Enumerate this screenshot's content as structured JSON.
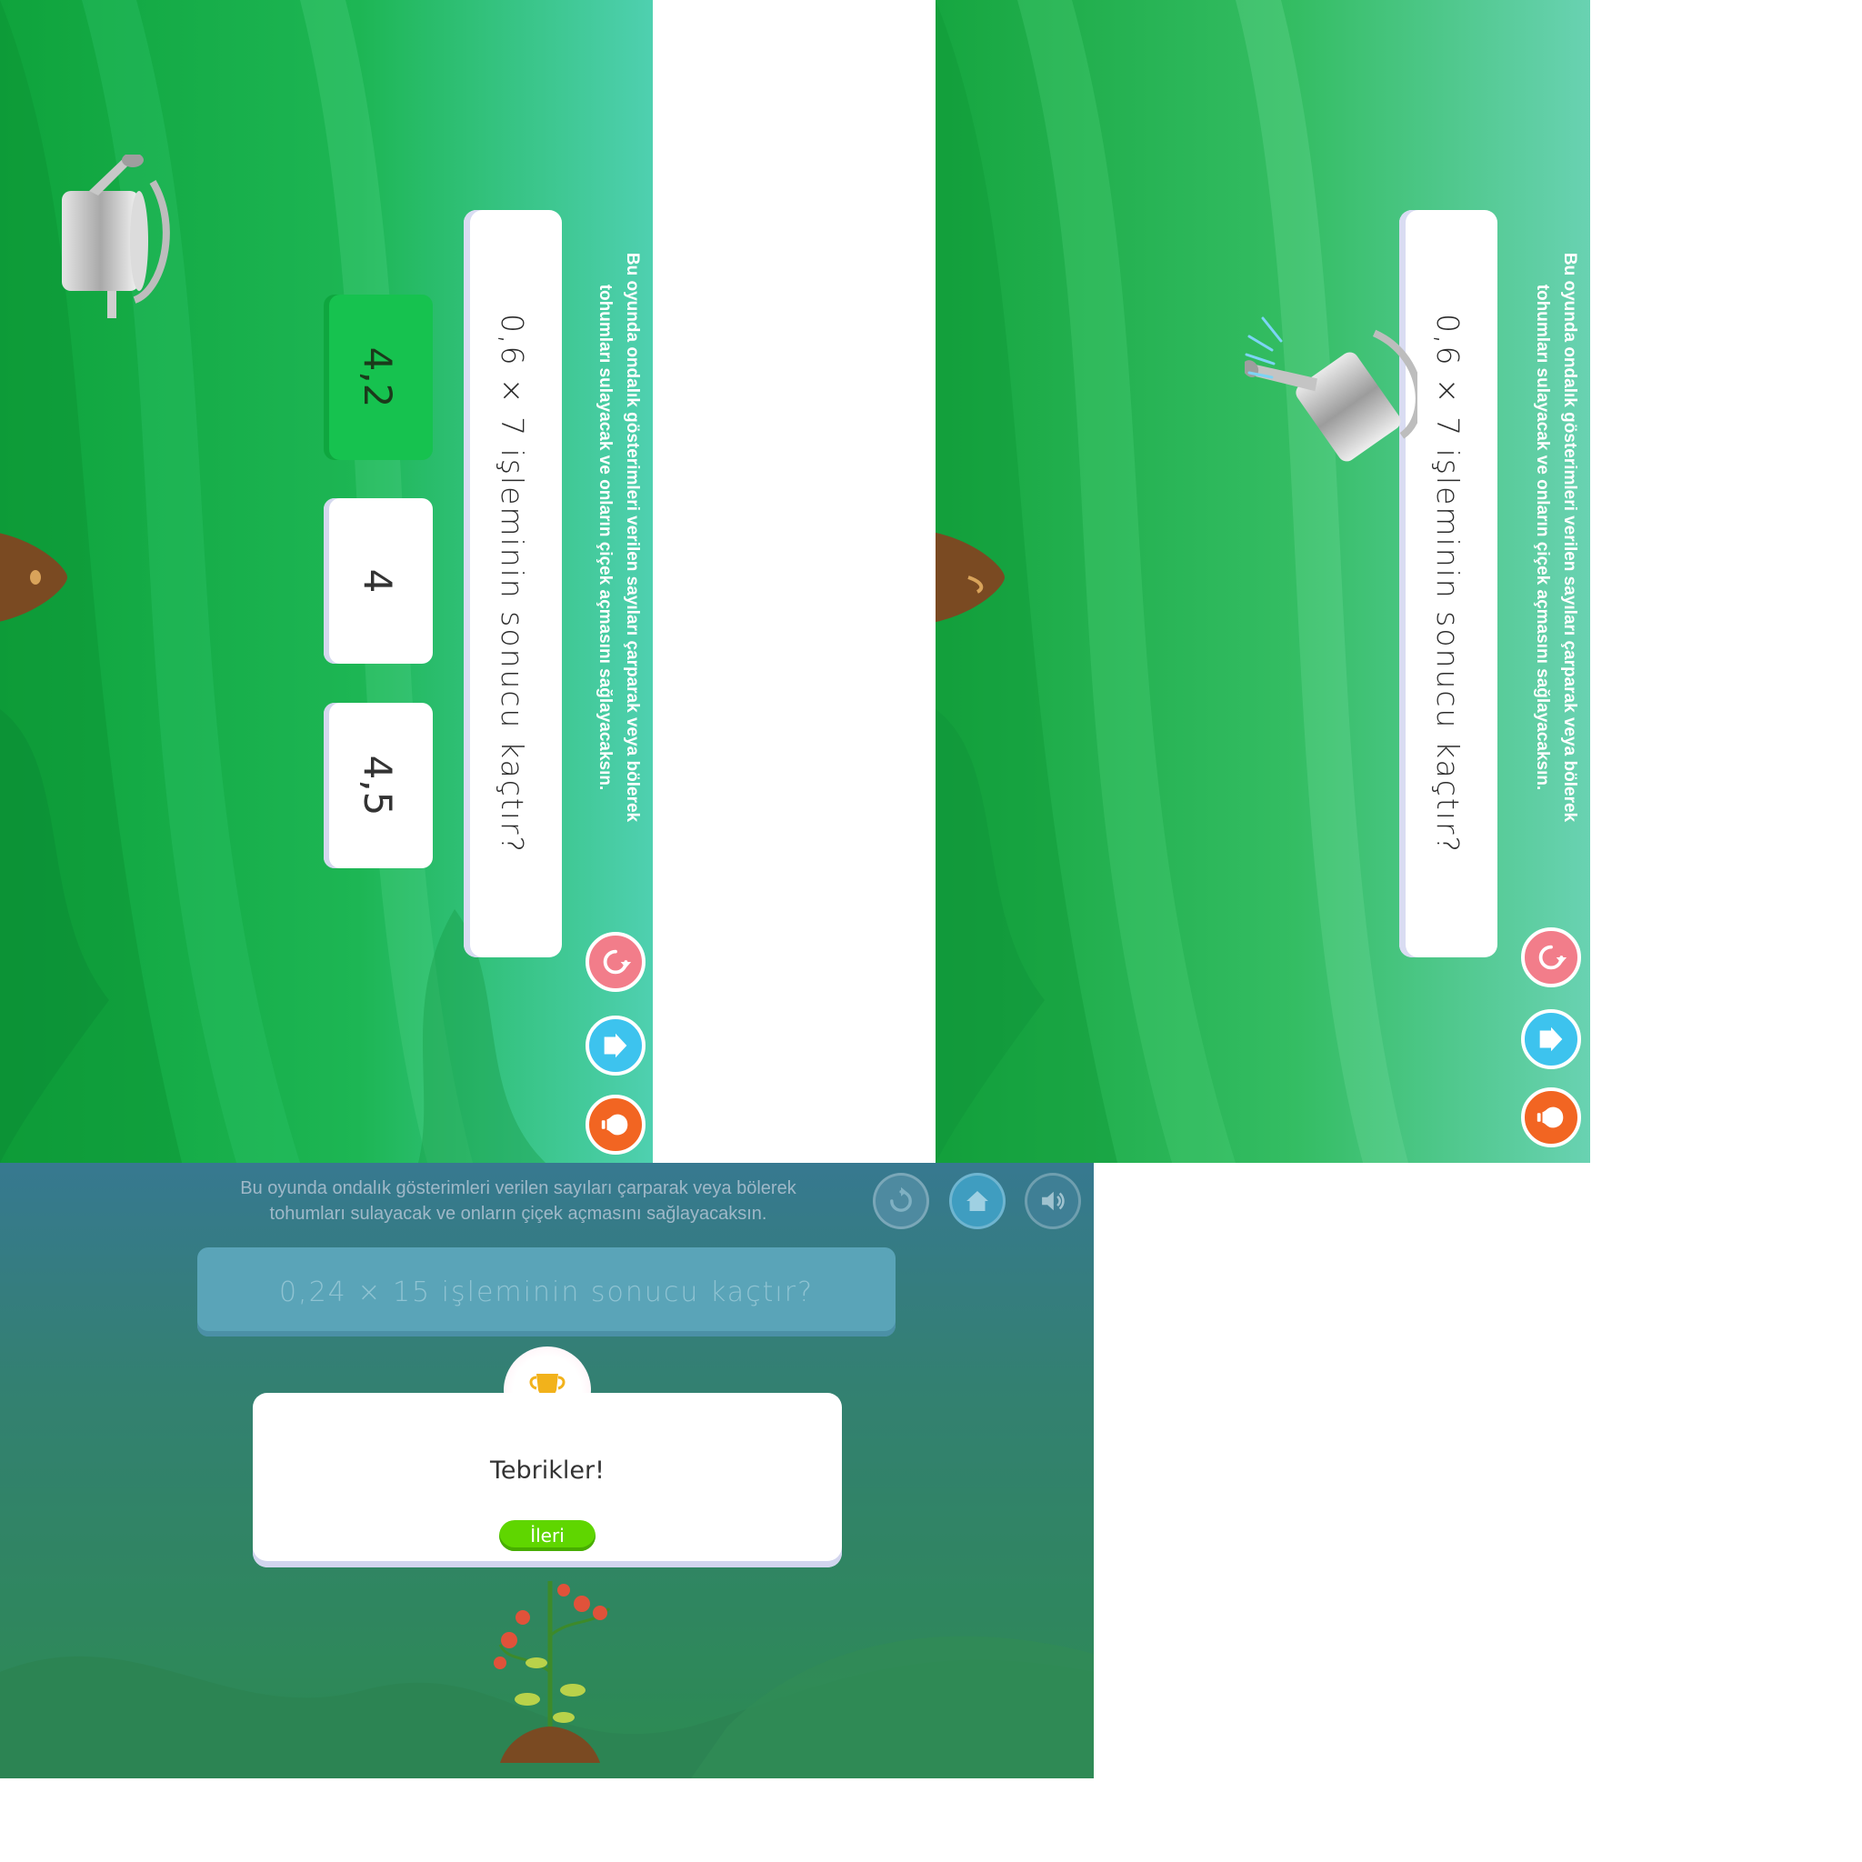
{
  "game": {
    "instruction_line1": "Bu oyunda ondalık gösterimleri verilen sayıları çarparak veya bölerek",
    "instruction_line2": "tohumları sulayacak ve onların çiçek açmasını sağlayacaksın.",
    "question": "0,6 × 7 işleminin sonucu kaçtır?",
    "options": [
      "4,2",
      "4",
      "4,5"
    ],
    "correct_option": "4,2"
  },
  "controls": {
    "restart": "restart-icon",
    "home": "home-icon",
    "hint": "hint-icon",
    "sound": "sound-icon"
  },
  "result_screen": {
    "question": "0,24 × 15 işleminin sonucu kaçtır?",
    "modal_title": "Tebrikler!",
    "next_label": "İleri",
    "badge_icon": "trophy-icon"
  },
  "colors": {
    "correct_green": "#16c24f",
    "restart_pink": "#f27d8a",
    "home_blue": "#3dc3ee",
    "hint_orange": "#f26522",
    "next_green": "#5fd600"
  }
}
